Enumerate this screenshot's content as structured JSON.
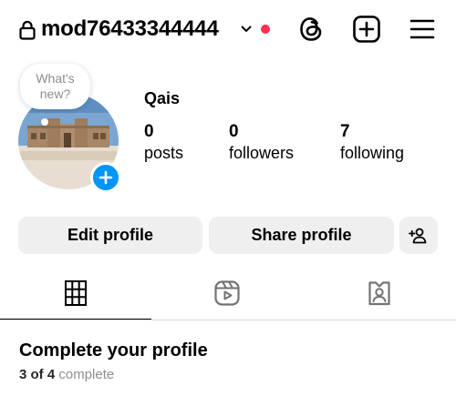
{
  "header": {
    "username": "mod76433344444",
    "icons": [
      "lock-icon",
      "chevron-down-icon",
      "threads-icon",
      "create-icon",
      "menu-icon"
    ]
  },
  "note": {
    "text": "What's new?"
  },
  "profile": {
    "name": "Qais",
    "stats": [
      {
        "count": "0",
        "label": "posts"
      },
      {
        "count": "0",
        "label": "followers"
      },
      {
        "count": "7",
        "label": "following"
      }
    ]
  },
  "actions": {
    "edit_label": "Edit profile",
    "share_label": "Share profile"
  },
  "tabs": [
    "grid-icon",
    "reels-icon",
    "tagged-icon"
  ],
  "complete_profile": {
    "title": "Complete your profile",
    "count": "3 of 4",
    "suffix": "complete"
  },
  "colors": {
    "accent_blue": "#0095f6",
    "notification_red": "#ff2d4f",
    "button_bg": "#efefef",
    "muted_text": "#8e8e8e"
  }
}
